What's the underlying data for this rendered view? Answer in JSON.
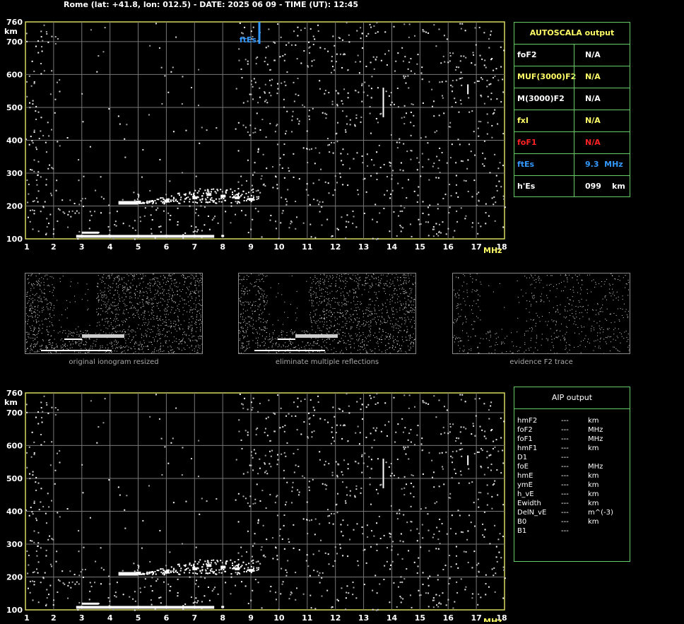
{
  "header": {
    "title": "Rome (lat: +41.8, lon: 012.5) - DATE: 2025 06 09 - TIME (UT): 12:45"
  },
  "ionogram": {
    "y_unit": "km",
    "x_unit": "MHz",
    "y_ticks": [
      "760",
      "700",
      "600",
      "500",
      "400",
      "300",
      "200",
      "100"
    ],
    "x_ticks": [
      "1",
      "2",
      "3",
      "4",
      "5",
      "6",
      "7",
      "8",
      "9",
      "10",
      "11",
      "12",
      "13",
      "14",
      "15",
      "16",
      "17",
      "18"
    ],
    "ftes_marker_label": "ftEs",
    "ftes_marker_mhz": 9.3
  },
  "autoscala": {
    "title": "AUTOSCALA output",
    "rows": [
      {
        "label": "foF2",
        "value": "N/A",
        "unit": "",
        "color": "#ffffff"
      },
      {
        "label": "MUF(3000)F2",
        "value": "N/A",
        "unit": "",
        "color": "#ffff66"
      },
      {
        "label": "M(3000)F2",
        "value": "N/A",
        "unit": "",
        "color": "#ffffff"
      },
      {
        "label": "fxI",
        "value": "N/A",
        "unit": "",
        "color": "#ffff66"
      },
      {
        "label": "foF1",
        "value": "N/A",
        "unit": "",
        "color": "#ff2222"
      },
      {
        "label": "ftEs",
        "value": "9.3  MHz",
        "unit": "",
        "color": "#3399ff"
      },
      {
        "label": "h'Es",
        "value": "099",
        "unit": "km",
        "color": "#ffffff"
      }
    ]
  },
  "thumbnails": [
    {
      "caption": "original ionogram resized"
    },
    {
      "caption": "eliminate multiple reflections"
    },
    {
      "caption": "evidence F2 trace"
    }
  ],
  "aip": {
    "title": "AIP output",
    "rows": [
      {
        "label": "hmF2",
        "value": "---",
        "unit": "km"
      },
      {
        "label": "foF2",
        "value": "---",
        "unit": "MHz"
      },
      {
        "label": "foF1",
        "value": "---",
        "unit": "MHz"
      },
      {
        "label": "hmF1",
        "value": "---",
        "unit": "km"
      },
      {
        "label": "D1",
        "value": "---",
        "unit": ""
      },
      {
        "label": "foE",
        "value": "---",
        "unit": "MHz"
      },
      {
        "label": "hmE",
        "value": "---",
        "unit": "km"
      },
      {
        "label": "ymE",
        "value": "---",
        "unit": "km"
      },
      {
        "label": "h_vE",
        "value": "---",
        "unit": "km"
      },
      {
        "label": "Ewidth",
        "value": "---",
        "unit": "km"
      },
      {
        "label": "DelN_vE",
        "value": "---",
        "unit": "m^(-3)"
      },
      {
        "label": "B0",
        "value": "---",
        "unit": "km"
      },
      {
        "label": "B1",
        "value": "---",
        "unit": ""
      }
    ]
  },
  "chart_data": [
    {
      "type": "scatter",
      "title": "",
      "xlabel": "MHz",
      "ylabel": "km",
      "xlim": [
        1,
        18
      ],
      "ylim": [
        100,
        760
      ],
      "grid": true,
      "series": [
        {
          "name": "",
          "points": [
            [
              3,
              110
            ],
            [
              4,
              110
            ],
            [
              5,
              110
            ],
            [
              6,
              110
            ],
            [
              7,
              110
            ],
            [
              8,
              110
            ],
            [
              4.5,
              210
            ],
            [
              5,
              212
            ],
            [
              6,
              215
            ],
            [
              7,
              225
            ],
            [
              7.5,
              235
            ],
            [
              8,
              230
            ],
            [
              8.5,
              225
            ],
            [
              9,
              220
            ]
          ]
        }
      ]
    },
    {
      "type": "scatter",
      "title": "",
      "xlabel": "MHz",
      "ylabel": "km",
      "xlim": [
        1,
        18
      ],
      "ylim": [
        100,
        760
      ],
      "grid": true,
      "series": [
        {
          "name": "",
          "points": [
            [
              3,
              110
            ],
            [
              4,
              110
            ],
            [
              5,
              110
            ],
            [
              6,
              110
            ],
            [
              7,
              110
            ],
            [
              8,
              110
            ],
            [
              4.5,
              210
            ],
            [
              5,
              212
            ],
            [
              6,
              215
            ],
            [
              7,
              225
            ],
            [
              7.5,
              235
            ],
            [
              8,
              230
            ],
            [
              8.5,
              225
            ],
            [
              9,
              220
            ]
          ]
        }
      ]
    }
  ]
}
